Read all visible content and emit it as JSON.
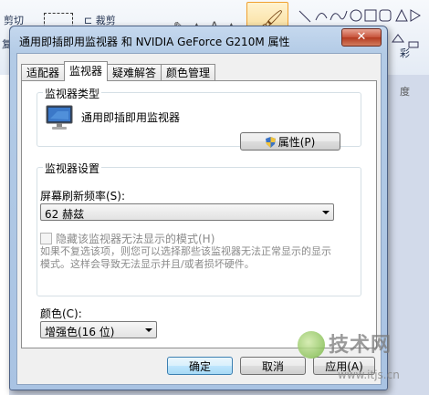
{
  "background_app": {
    "cut_label": "剪切",
    "crop_label": "裁剪",
    "left_fragment": "复",
    "right_fragment": "彩",
    "middle_fragment": "度"
  },
  "dialog": {
    "title": "通用即插即用监视器 和 NVIDIA GeForce G210M  属性",
    "close_glyph": "✕",
    "tabs": [
      {
        "label": "适配器",
        "active": false
      },
      {
        "label": "监视器",
        "active": true
      },
      {
        "label": "疑难解答",
        "active": false
      },
      {
        "label": "颜色管理",
        "active": false
      }
    ],
    "monitor_type": {
      "group_label": "监视器类型",
      "monitor_name": "通用即插即用监视器",
      "properties_button": "属性(P)"
    },
    "monitor_settings": {
      "group_label": "监视器设置",
      "refresh_label": "屏幕刷新频率(S):",
      "refresh_value": "62 赫兹",
      "hide_modes_label": "隐藏该监视器无法显示的模式(H)",
      "help_text": "如果不复选该项，则您可以选择那些该监视器无法正常显示的显示模式。这样会导致无法显示并且/或者损坏硬件。"
    },
    "color": {
      "label": "颜色(C):",
      "value": "增强色(16 位)"
    },
    "buttons": {
      "ok": "确定",
      "cancel": "取消",
      "apply": "应用(A)"
    }
  },
  "watermark": {
    "site_name": "技术网",
    "url": "www.itjs.cn"
  },
  "colors": {
    "title_gradient": "#b3cbe6",
    "close_button": "#c7533a",
    "focused_button": "#a7d9f5"
  }
}
